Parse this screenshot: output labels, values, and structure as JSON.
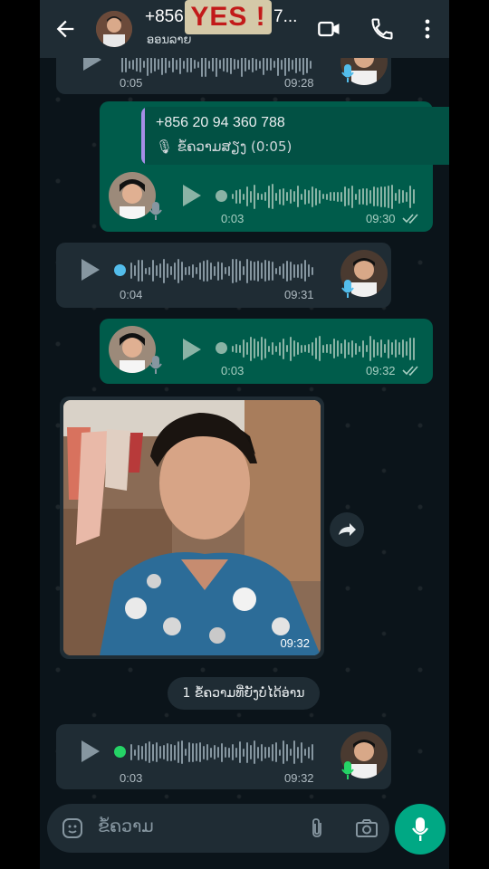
{
  "header": {
    "contact_name": "+856",
    "contact_name_cont": "7...",
    "sticker_text": "YES !",
    "status": "ອອນລາຍ"
  },
  "messages": [
    {
      "type": "voice",
      "direction": "in",
      "duration": "0:05",
      "time": "09:28"
    },
    {
      "type": "voice",
      "direction": "out",
      "quoted_sender": "+856 20 94 360 788",
      "quoted_text": "🎙 ຂໍ້ຄວາມສຽງ (0:05)",
      "duration": "0:03",
      "time": "09:30"
    },
    {
      "type": "voice",
      "direction": "in",
      "duration": "0:04",
      "time": "09:31"
    },
    {
      "type": "voice",
      "direction": "out",
      "duration": "0:03",
      "time": "09:32"
    },
    {
      "type": "photo",
      "direction": "in",
      "time": "09:32"
    },
    {
      "type": "voice",
      "direction": "in",
      "duration": "0:03",
      "time": "09:32"
    }
  ],
  "unread_banner": "1 ຂໍ້ຄວາມທີ່ຍັງບໍ່ໄດ້ອ່ານ",
  "composer": {
    "placeholder": "ຂໍ້ຄວາມ"
  },
  "colors": {
    "accent": "#00a884",
    "outgoing": "#005c4b",
    "incoming": "#1f2c34",
    "played_dot": "#53bdeb"
  }
}
